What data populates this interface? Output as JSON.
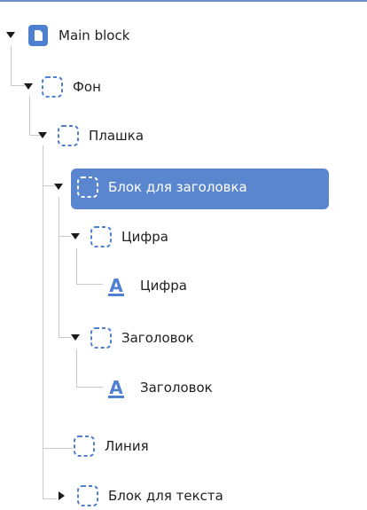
{
  "tree": {
    "main_block": {
      "label": "Main block",
      "icon": "document-icon",
      "expanded": true
    },
    "fon": {
      "label": "Фон",
      "icon": "frame-icon",
      "expanded": true
    },
    "plashka": {
      "label": "Плашка",
      "icon": "frame-icon",
      "expanded": true
    },
    "blok_zagolovka": {
      "label": "Блок для заголовка",
      "icon": "frame-icon",
      "expanded": true,
      "selected": true
    },
    "cifra_group": {
      "label": "Цифра",
      "icon": "frame-icon",
      "expanded": true
    },
    "cifra_text": {
      "label": "Цифра",
      "icon": "text-layer-icon"
    },
    "zagolovok_group": {
      "label": "Заголовок",
      "icon": "frame-icon",
      "expanded": true
    },
    "zagolovok_text": {
      "label": "Заголовок",
      "icon": "text-layer-icon"
    },
    "liniya": {
      "label": "Линия",
      "icon": "frame-icon"
    },
    "blok_teksta": {
      "label": "Блок для текста",
      "icon": "frame-icon",
      "expanded": false
    }
  },
  "colors": {
    "accent": "#5a86cf",
    "icon_blue": "#4f7fd0",
    "selected_text": "#ffffff",
    "connector": "#c9c9c9"
  }
}
